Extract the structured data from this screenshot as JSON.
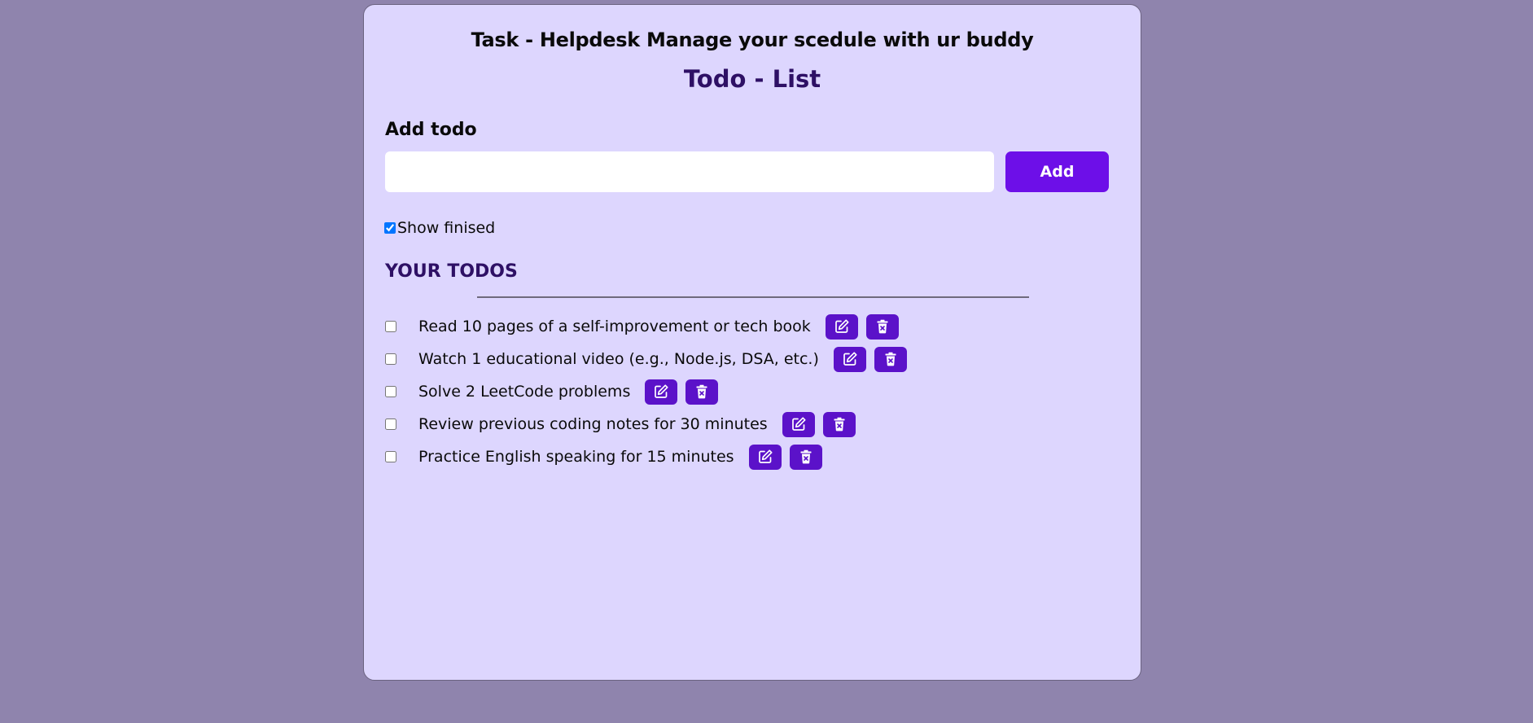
{
  "app": {
    "title": "Task - Helpdesk Manage your scedule with ur buddy",
    "subtitle": "Todo - List"
  },
  "add_form": {
    "heading": "Add todo",
    "input_value": "",
    "input_placeholder": "",
    "button_label": "Add"
  },
  "filter": {
    "show_finished_label": "Show finised",
    "show_finished_checked": true
  },
  "todos_section": {
    "heading": "YOUR TODOS",
    "items": [
      {
        "text": "Read 10 pages of a self-improvement or tech book",
        "done": false,
        "edit_icon": "edit-icon",
        "delete_icon": "delete-icon"
      },
      {
        "text": "Watch 1 educational video (e.g., Node.js, DSA, etc.)",
        "done": false,
        "edit_icon": "edit-icon",
        "delete_icon": "delete-icon"
      },
      {
        "text": "Solve 2 LeetCode problems",
        "done": false,
        "edit_icon": "edit-icon",
        "delete_icon": "delete-icon"
      },
      {
        "text": "Review previous coding notes for 30 minutes",
        "done": false,
        "edit_icon": "edit-icon",
        "delete_icon": "delete-icon"
      },
      {
        "text": "Practice English speaking for 15 minutes",
        "done": false,
        "edit_icon": "edit-icon",
        "delete_icon": "delete-icon"
      }
    ]
  },
  "colors": {
    "page_background": "#8f84ad",
    "card_background": "#ddd6fe",
    "accent": "#6d0fe8",
    "icon_button": "#5b12c9",
    "heading_purple": "#2e1065"
  }
}
